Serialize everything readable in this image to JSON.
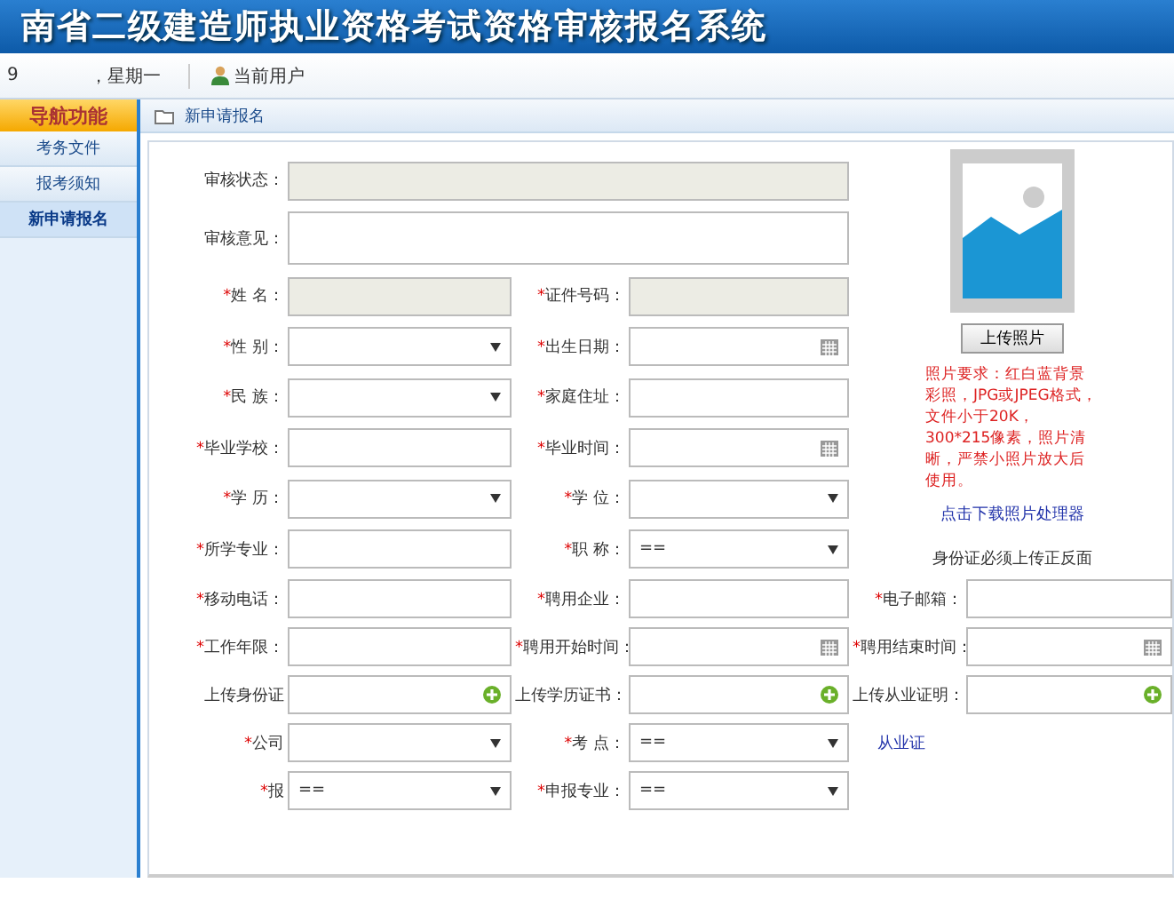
{
  "header": {
    "title": "南省二级建造师执业资格考试资格审核报名系统"
  },
  "info_bar": {
    "date": "9",
    "weekday": "，星期一",
    "user_label": "当前用户"
  },
  "sidebar": {
    "title": "导航功能",
    "items": [
      {
        "label": "考务文件",
        "selected": false
      },
      {
        "label": "报考须知",
        "selected": false
      },
      {
        "label": "新申请报名",
        "selected": true
      }
    ]
  },
  "panel": {
    "title": "新申请报名"
  },
  "form": [
    {
      "label": "审核状态：",
      "kind": "readonly",
      "wide": true
    },
    {
      "label": "审核意见：",
      "kind": "textarea",
      "wide": true
    },
    {
      "mark": "*",
      "label": "姓 名：",
      "kind": "readonly"
    },
    {
      "mark": "*",
      "label": "证件号码：",
      "kind": "readonly"
    },
    {
      "mark": "*",
      "label": "性 别：",
      "kind": "select"
    },
    {
      "mark": "*",
      "label": "出生日期：",
      "kind": "date"
    },
    {
      "mark": "*",
      "label": "民 族：",
      "kind": "select"
    },
    {
      "mark": "*",
      "label": "家庭住址：",
      "kind": "text"
    },
    {
      "mark": "*",
      "label": "毕业学校：",
      "kind": "text"
    },
    {
      "mark": "*",
      "label": "毕业时间：",
      "kind": "date"
    },
    {
      "mark": "*",
      "label": "学 历：",
      "kind": "select"
    },
    {
      "mark": "*",
      "label": "学 位：",
      "kind": "select"
    },
    {
      "mark": "*",
      "label": "所学专业：",
      "kind": "text"
    },
    {
      "mark": "*",
      "label": "职 称：",
      "kind": "select",
      "value": "=="
    }
  ],
  "photo": {
    "button": "上传照片",
    "requirement": "照片要求：红白蓝背景彩照，JPG或JPEG格式，文件小于20K，300*215像素，照片清晰，严禁小照片放大后使用。",
    "link": "点击下载照片处理器",
    "note": "身份证必须上传正反面"
  },
  "form_lower": [
    {
      "mark": "*",
      "label": "移动电话：",
      "kind": "text"
    },
    {
      "mark": "*",
      "label": "聘用企业：",
      "kind": "text"
    },
    {
      "mark": "*",
      "label": "电子邮箱：",
      "kind": "text"
    },
    {
      "mark": "*",
      "label": "工作年限：",
      "kind": "text"
    },
    {
      "mark": "*",
      "label": "聘用开始时间：",
      "kind": "date"
    },
    {
      "mark": "*",
      "label": "聘用结束时间：",
      "kind": "date"
    },
    {
      "label": "上传身份证",
      "kind": "upload"
    },
    {
      "label": "上传学历证书：",
      "kind": "upload"
    },
    {
      "label": "上传从业证明：",
      "kind": "upload"
    },
    {
      "mark": "*",
      "label": "公司",
      "kind": "select"
    },
    {
      "mark": "*",
      "label": "考 点：",
      "kind": "select",
      "value": "=="
    },
    {
      "label": "从业证",
      "kind": "link"
    },
    {
      "mark": "*",
      "label": "报",
      "kind": "select",
      "value": "=="
    },
    {
      "mark": "*",
      "label": "申报专业：",
      "kind": "select",
      "value": "=="
    }
  ]
}
